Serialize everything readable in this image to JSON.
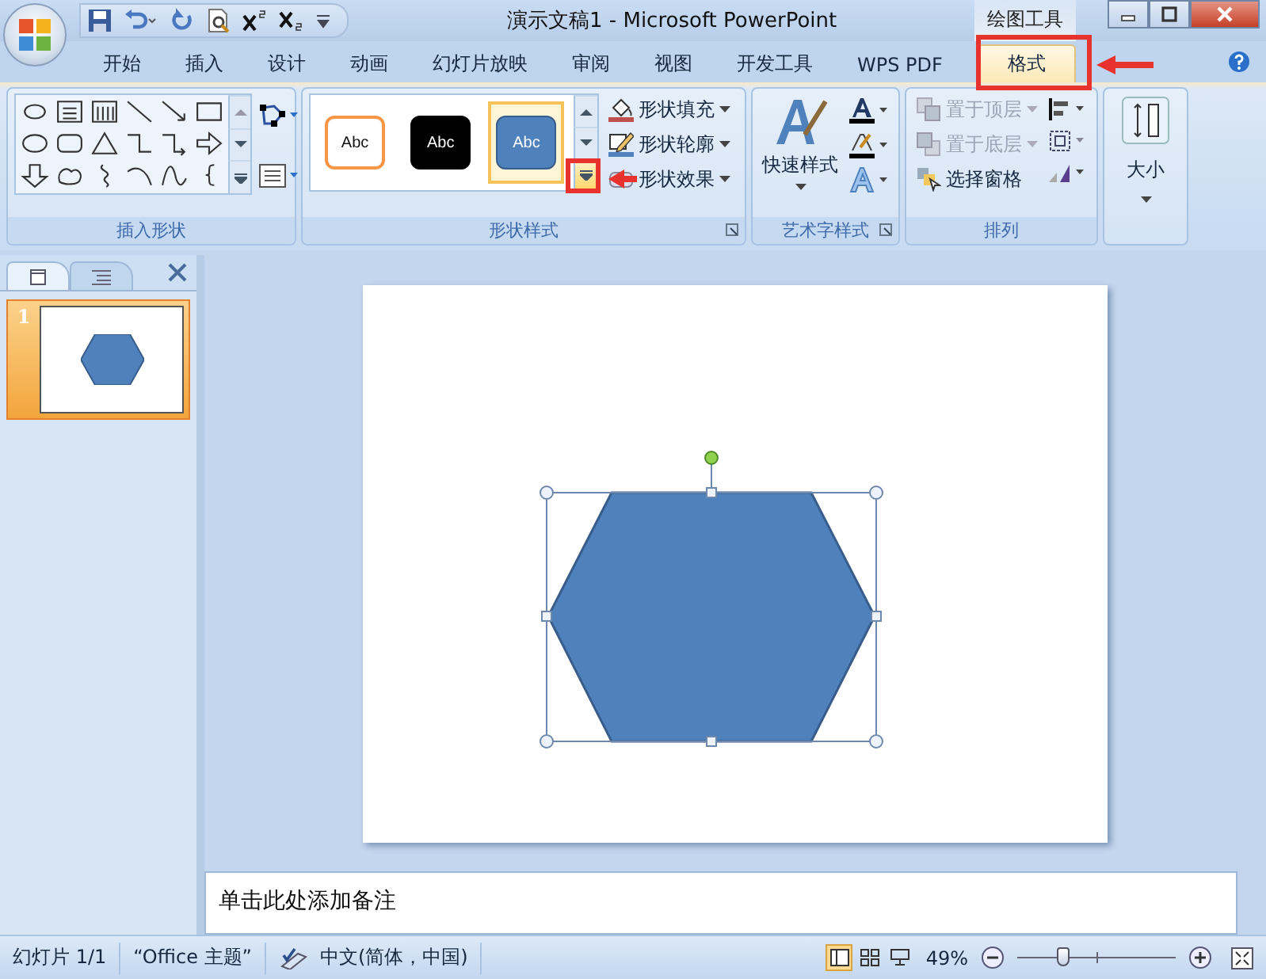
{
  "window": {
    "title": "演示文稿1 - Microsoft PowerPoint",
    "context_label": "绘图工具"
  },
  "tabs": [
    {
      "label": "开始",
      "selected": false
    },
    {
      "label": "插入",
      "selected": false
    },
    {
      "label": "设计",
      "selected": false
    },
    {
      "label": "动画",
      "selected": false
    },
    {
      "label": "幻灯片放映",
      "selected": false
    },
    {
      "label": "审阅",
      "selected": false
    },
    {
      "label": "视图",
      "selected": false
    },
    {
      "label": "开发工具",
      "selected": false
    },
    {
      "label": "WPS PDF",
      "selected": false
    },
    {
      "label": "格式",
      "selected": true
    }
  ],
  "insert_shapes": {
    "title": "插入形状"
  },
  "shape_styles": {
    "title": "形状样式",
    "presets": [
      {
        "label": "Abc",
        "kind": "outline",
        "selected": false
      },
      {
        "label": "Abc",
        "kind": "dark",
        "selected": false
      },
      {
        "label": "Abc",
        "kind": "filled",
        "selected": true
      }
    ],
    "commands": [
      {
        "label": "形状填充",
        "kind": "fill"
      },
      {
        "label": "形状轮廓",
        "kind": "outline"
      },
      {
        "label": "形状效果",
        "kind": "effects"
      }
    ]
  },
  "wordart_styles": {
    "title": "艺术字样式",
    "quick_styles": "快速样式"
  },
  "arrange": {
    "title": "排列",
    "commands": [
      {
        "label": "置于顶层",
        "kind": "front",
        "disabled": true
      },
      {
        "label": "置于底层",
        "kind": "back",
        "disabled": true
      },
      {
        "label": "选择窗格",
        "kind": "pane",
        "disabled": false
      }
    ]
  },
  "size": {
    "label": "大小"
  },
  "slides_panel": {
    "slides": [
      {
        "number": "1",
        "selected": true
      }
    ]
  },
  "slide": {
    "shape": {
      "kind": "hexagon",
      "selected": true
    }
  },
  "notes": {
    "placeholder": "单击此处添加备注"
  },
  "status_bar": {
    "slide_info": "幻灯片 1/1",
    "theme": "“Office 主题”",
    "language": "中文(简体，中国)",
    "views": [
      {
        "kind": "normal",
        "selected": true
      },
      {
        "kind": "sorter",
        "selected": false
      },
      {
        "kind": "show",
        "selected": false
      }
    ],
    "zoom": "49%",
    "zoom_slider": {
      "level": 0.29
    }
  }
}
